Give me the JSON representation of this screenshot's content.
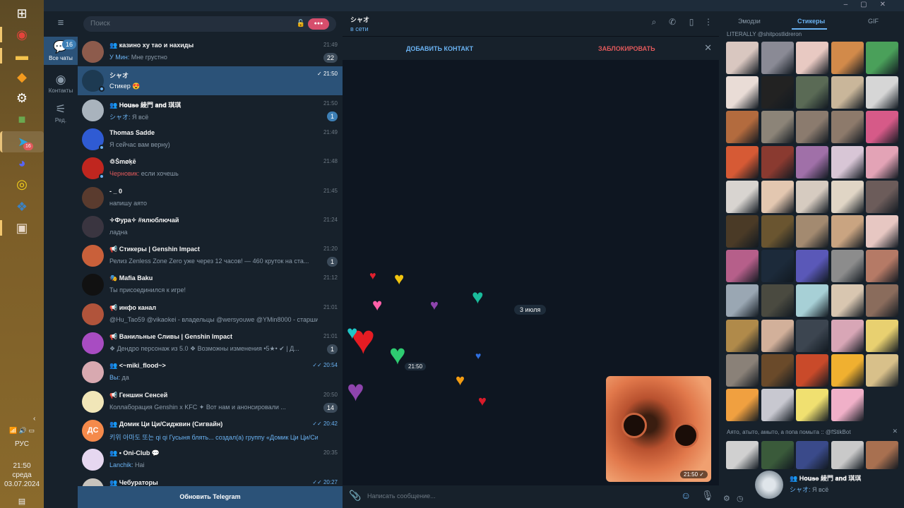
{
  "taskbar": {
    "apps": [
      {
        "icon": "windows-start-icon",
        "glyph": "⊞"
      },
      {
        "icon": "chrome-icon",
        "glyph": "◉",
        "color": "#e4433b"
      },
      {
        "icon": "file-explorer-icon",
        "glyph": "▬",
        "color": "#f4c34d"
      },
      {
        "icon": "app-orange-icon",
        "glyph": "◆",
        "color": "#f39a1e"
      },
      {
        "icon": "settings-icon",
        "glyph": "⚙",
        "color": "#ffffff"
      },
      {
        "icon": "minecraft-icon",
        "glyph": "■",
        "color": "#6aa84f"
      },
      {
        "icon": "telegram-icon",
        "glyph": "➤",
        "color": "#2aa3e0",
        "badge": "16"
      },
      {
        "icon": "discord-icon",
        "glyph": "◕",
        "color": "#5865f2"
      },
      {
        "icon": "app-yellow-ring-icon",
        "glyph": "◎",
        "color": "#f7d31a"
      },
      {
        "icon": "app-blue-icon",
        "glyph": "❖",
        "color": "#3b82c4"
      },
      {
        "icon": "photo-app-icon",
        "glyph": "▣",
        "color": "#e8d8c8"
      }
    ],
    "tray": {
      "lang": "РУС",
      "time": "21:50",
      "day": "среда",
      "date": "03.07.2024"
    }
  },
  "rail": {
    "items": [
      {
        "label": "Все чаты",
        "icon": "chats-icon",
        "badge": "16"
      },
      {
        "label": "Контакты",
        "icon": "contacts-icon"
      },
      {
        "label": "Ред.",
        "icon": "edit-folders-icon"
      }
    ]
  },
  "search": {
    "placeholder": "Поиск"
  },
  "chats": [
    {
      "name": "казино ху тао и нахиды",
      "time": "21:49",
      "sender": "У Мин:",
      "preview": "Мне грустно",
      "badge": "22",
      "badge_style": "grey",
      "group": true,
      "avatar_color": "#8d5b4c"
    },
    {
      "name": "シャオ",
      "time": "21:50",
      "preview": "Стикер 😍",
      "selected": true,
      "check": "✓",
      "online": true,
      "avatar_color": "#1d3a52"
    },
    {
      "name": "H𝐨𝐮𝐬𝐞 綾門 𝐚𝐧𝐝 琪琪",
      "time": "21:50",
      "sender": "シャオ:",
      "preview": "Я всё",
      "badge": "1",
      "badge_style": "blue",
      "group": true,
      "avatar_color": "#a9b3bd"
    },
    {
      "name": "Thomas Sadde",
      "time": "21:49",
      "preview": "Я сейчас вам верну)",
      "online": true,
      "avatar_color": "#2f5bd3"
    },
    {
      "name": "♲Šmøķē",
      "time": "21:48",
      "draft": "Черновик:",
      "preview": "если хочешь",
      "online": true,
      "avatar_color": "#c0261f"
    },
    {
      "name": "- _ 0",
      "time": "21:45",
      "preview": "напишу аято",
      "avatar_color": "#5a3b2e"
    },
    {
      "name": "✧Фура✧ #ялюблючай",
      "time": "21:24",
      "preview": "ладна",
      "avatar_color": "#3a3540"
    },
    {
      "name": "📢 Стикеры | Genshin Impact",
      "time": "21:20",
      "preview": "Релиз Zenless Zone Zero уже через 12 часов! — 460 круток на ста...",
      "badge": "1",
      "badge_style": "grey",
      "avatar_color": "#c9603a"
    },
    {
      "name": "🎭 Mafia Baku",
      "time": "21:12",
      "preview": "Ты присоединился к игре!",
      "avatar_color": "#111111"
    },
    {
      "name": "📢 инфо канал",
      "time": "21:01",
      "preview": "@Hu_Tao59 @vikaokei - владельцы @wersyouwe @YMin8000 - старшие ад...",
      "avatar_color": "#b1543b"
    },
    {
      "name": "📢 Ванильные Сливы | Genshin Impact",
      "time": "21:01",
      "preview": "❖ Дендро персонаж из 5.0 ❖ Возможны изменения •5★• ✔ | Д...",
      "badge": "1",
      "badge_style": "grey",
      "avatar_color": "#a84cc2"
    },
    {
      "name": "<~miki_flood~>",
      "time": "20:54",
      "sender": "Вы:",
      "preview": "да",
      "check": "✓✓",
      "group": true,
      "avatar_color": "#d8a9b0"
    },
    {
      "name": "📢 Геншин Сенсей",
      "time": "20:50",
      "preview": "Коллаборация Genshin x KFC ✦ Вот нам и анонсировали ...",
      "badge": "14",
      "badge_style": "grey",
      "avatar_color": "#f1e6b8"
    },
    {
      "name": "Домик Ци Ци/Сиджвин (Сигвайн)",
      "time": "20:42",
      "preview": "키위 아마도 또는 qi qi Гусыня блять... создал(а) группу «Домик Ци Ци/Сиджви...",
      "check": "✓✓",
      "group": true,
      "avatar_text": "ДС",
      "avatar_color": "#f58a4b",
      "preview_blue": true
    },
    {
      "name": "• Oni-Club 💬",
      "time": "20:35",
      "sender": "Lanchik:",
      "preview": "Hai",
      "group": true,
      "avatar_color": "#e6d7f0"
    },
    {
      "name": "Чебураторы",
      "time": "20:27",
      "check": "✓✓",
      "group": true,
      "avatar_color": "#c7c3bd"
    }
  ],
  "update_button": "Обновить Telegram",
  "chat": {
    "peer": "シャオ",
    "status": "в сети",
    "add_contact": "ДОБАВИТЬ КОНТАКТ",
    "block": "ЗАБЛОКИРОВАТЬ",
    "date_chip": "3 июля",
    "sticker_time": "21:50",
    "photo_time": "21:50",
    "photo_check": "✓",
    "composer_placeholder": "Написать сообщение..."
  },
  "hearts": [
    {
      "color": "#e0202e"
    },
    {
      "color": "#f1c40f"
    },
    {
      "color": "#ff5fa8"
    },
    {
      "color": "#8e44ad"
    },
    {
      "color": "#1abc9c"
    },
    {
      "color": "#e51c23"
    },
    {
      "color": "#2ecc71"
    },
    {
      "color": "#20c6c6"
    },
    {
      "color": "#8e44ad"
    },
    {
      "color": "#f39c12"
    },
    {
      "color": "#2f6fe0"
    },
    {
      "color": "#d81b2a"
    }
  ],
  "stickers": {
    "tabs": [
      "Эмодзи",
      "Стикеры",
      "GIF"
    ],
    "active_tab": "Стикеры",
    "pack1_title": "LITERALLY @shitpostlidreron",
    "pack2_title": "Аято, атыто, амыто, а попа помыта :: @fStikBot",
    "pack1_colors": [
      "#d9c7c0",
      "#8a8a95",
      "#e8c9c2",
      "#d28a4a",
      "#4aa05a",
      "#e9dcd6",
      "#222222",
      "#5a6a55",
      "#c9b69a",
      "#d6d6d6",
      "#b36b3e",
      "#8c8478",
      "#8b7b6e",
      "#8d7a6b",
      "#d65a88",
      "#d65a35",
      "#8a3a30",
      "#a070a8",
      "#d8c6d6",
      "#e3a3b6",
      "#d8d4d0",
      "#e3c7b0",
      "#d6cbc0",
      "#e0d5c5",
      "#6c5c5a",
      "#4a3a26",
      "#6a5530",
      "#a38a70",
      "#c9a481",
      "#e7c7c2",
      "#b65f8a",
      "#1c2a3a",
      "#5a58b8",
      "#8c8c8c",
      "#b57a66",
      "#9aa7b3",
      "#4a4a40",
      "#a7d0d6",
      "#d8c6b0",
      "#8a6c5c",
      "#b08a4a",
      "#d2b09a",
      "#3c4550",
      "#d8a6b6",
      "#e8d070",
      "#8a8178",
      "#6a4a2a",
      "#c94a2a",
      "#f0b030",
      "#d8c08a",
      "#f0a040",
      "#c8c8d0",
      "#f0e070",
      "#f0b0c8"
    ],
    "pack2_colors": [
      "#d0d0d0",
      "#3a5a3a",
      "#3a4a8a",
      "#c9c9c9",
      "#a87050"
    ],
    "bottom_icons": [
      "settings-icon",
      "recent-icon"
    ]
  },
  "notification": {
    "title": "H𝐨𝐮𝐬𝐞 綾門 𝐚𝐧𝐝 琪琪",
    "sender": "シャオ:",
    "message": "Я всё"
  }
}
